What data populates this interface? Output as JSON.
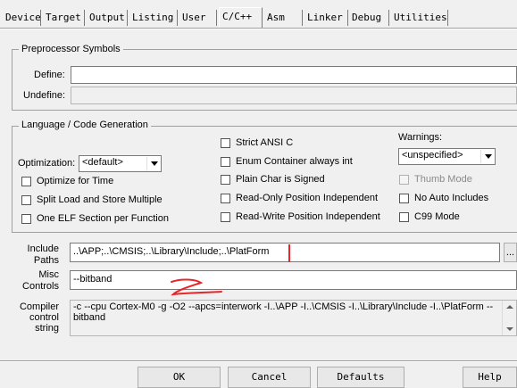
{
  "tabs": [
    {
      "label": "Device"
    },
    {
      "label": "Target"
    },
    {
      "label": "Output"
    },
    {
      "label": "Listing"
    },
    {
      "label": "User"
    },
    {
      "label": "C/C++"
    },
    {
      "label": "Asm"
    },
    {
      "label": "Linker"
    },
    {
      "label": "Debug"
    },
    {
      "label": "Utilities"
    }
  ],
  "preprocessor": {
    "title": "Preprocessor Symbols",
    "define_label": "Define:",
    "define_value": "",
    "undefine_label": "Undefine:",
    "undefine_value": ""
  },
  "codegen": {
    "title": "Language / Code Generation",
    "optimization_label": "Optimization:",
    "optimization_value": "<default>",
    "optimize_for_time": "Optimize for Time",
    "split_load_store": "Split Load and Store Multiple",
    "one_elf_section": "One ELF Section per Function",
    "strict_ansi_c": "Strict ANSI C",
    "enum_container": "Enum Container always int",
    "plain_char_signed": "Plain Char is Signed",
    "ro_position_independent": "Read-Only Position Independent",
    "rw_position_independent": "Read-Write Position Independent",
    "warnings_label": "Warnings:",
    "warnings_value": "<unspecified>",
    "thumb_mode": "Thumb Mode",
    "no_auto_includes": "No Auto Includes",
    "c99_mode": "C99 Mode"
  },
  "include_paths": {
    "label_line1": "Include",
    "label_line2": "Paths",
    "value": "..\\APP;..\\CMSIS;..\\Library\\Include;..\\PlatForm",
    "browse": "..."
  },
  "misc_controls": {
    "label_line1": "Misc",
    "label_line2": "Controls",
    "value": "--bitband"
  },
  "compiler_control": {
    "label_line1": "Compiler",
    "label_line2": "control",
    "label_line3": "string",
    "value": "-c --cpu Cortex-M0 -g -O2 --apcs=interwork -I..\\APP -I..\\CMSIS -I..\\Library\\Include -I..\\PlatForm --bitband"
  },
  "buttons": {
    "ok": "OK",
    "cancel": "Cancel",
    "defaults": "Defaults",
    "help": "Help"
  },
  "colors": {
    "background": "#f0f0f0",
    "annotation_red": "#e8262a"
  }
}
